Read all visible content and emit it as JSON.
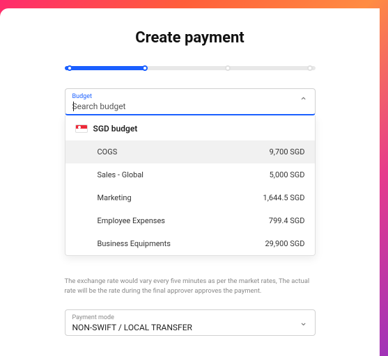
{
  "title": "Create payment",
  "budget": {
    "label": "Budget",
    "placeholder": "Search budget",
    "parent": "SGD budget",
    "items": [
      {
        "name": "COGS",
        "amount": "9,700 SGD"
      },
      {
        "name": "Sales - Global",
        "amount": "5,000 SGD"
      },
      {
        "name": "Marketing",
        "amount": "1,644.5 SGD"
      },
      {
        "name": "Employee Expenses",
        "amount": "799.4 SGD"
      },
      {
        "name": "Business Equipments",
        "amount": "29,900 SGD"
      }
    ]
  },
  "rate_note": "The exchange rate would vary every five minutes as per the market rates, The actual rate will be the rate during the final approver approves the payment.",
  "payment_mode": {
    "label": "Payment mode",
    "value": "NON-SWIFT / LOCAL TRANSFER"
  }
}
